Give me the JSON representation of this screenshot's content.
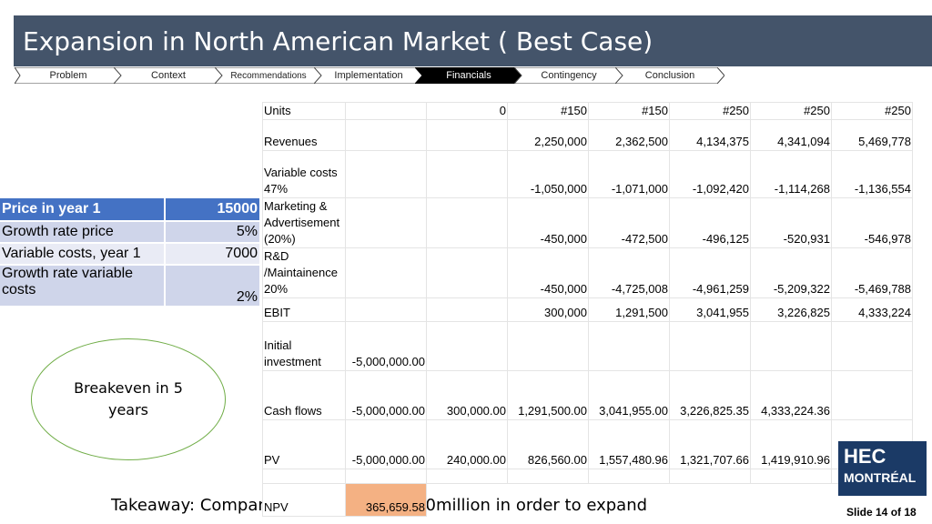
{
  "title": "Expansion in North American Market ( Best Case)",
  "nav": {
    "items": [
      "Problem",
      "Context",
      "Recommendations",
      "Implementation",
      "Financials",
      "Contingency",
      "Conclusion"
    ],
    "active": "Financials",
    "active_color": "#000000"
  },
  "params": {
    "header": {
      "label": "Price in year 1",
      "value": "15000"
    },
    "rows": [
      {
        "label": "Growth rate price",
        "value": "5%"
      },
      {
        "label": "Variable costs, year 1",
        "value": "7000"
      },
      {
        "label": "Growth rate variable costs",
        "value": "2%"
      }
    ],
    "header_color": "#4472c4"
  },
  "financials": {
    "rows": [
      {
        "label": "Units",
        "cells": [
          "",
          "0",
          "#150",
          "#150",
          "#250",
          "#250",
          "#250"
        ]
      },
      {
        "label": "Revenues",
        "cells": [
          "",
          "",
          "2,250,000",
          "2,362,500",
          "4,134,375",
          "4,341,094",
          "5,469,778"
        ]
      },
      {
        "label": "Variable costs 47%",
        "cells": [
          "",
          "",
          "-1,050,000",
          "-1,071,000",
          "-1,092,420",
          "-1,114,268",
          "-1,136,554"
        ]
      },
      {
        "label": "Marketing & Advertisement (20%)",
        "cells": [
          "",
          "",
          "-450,000",
          "-472,500",
          "-496,125",
          "-520,931",
          "-546,978"
        ]
      },
      {
        "label": "R&D /Maintainence 20%",
        "cells": [
          "",
          "",
          "-450,000",
          "-4,725,008",
          "-4,961,259",
          "-5,209,322",
          "-5,469,788"
        ]
      },
      {
        "label": "EBIT",
        "cells": [
          "",
          "",
          "300,000",
          "1,291,500",
          "3,041,955",
          "3,226,825",
          "4,333,224"
        ]
      },
      {
        "label": "Initial investment",
        "cells": [
          "-5,000,000.00",
          "",
          "",
          "",
          "",
          "",
          ""
        ]
      },
      {
        "label": "Cash flows",
        "cells": [
          "-5,000,000.00",
          "300,000.00",
          "1,291,500.00",
          "3,041,955.00",
          "3,226,825.35",
          "4,333,224.36",
          ""
        ]
      },
      {
        "label": "PV",
        "cells": [
          "-5,000,000.00",
          "240,000.00",
          "826,560.00",
          "1,557,480.96",
          "1,321,707.66",
          "1,419,910.96",
          ""
        ]
      }
    ],
    "npv": {
      "label": "NPV",
      "value": "365,659.58"
    },
    "npv_color": "#f4b183"
  },
  "oval_text": "Breakeven in 5 years",
  "takeaway": "Takeaway: Company needs to raise 150million in order to expand",
  "logo": {
    "line1": "HEC",
    "line2": "MONTRÉAL"
  },
  "slide_number": "Slide 14 of 18"
}
